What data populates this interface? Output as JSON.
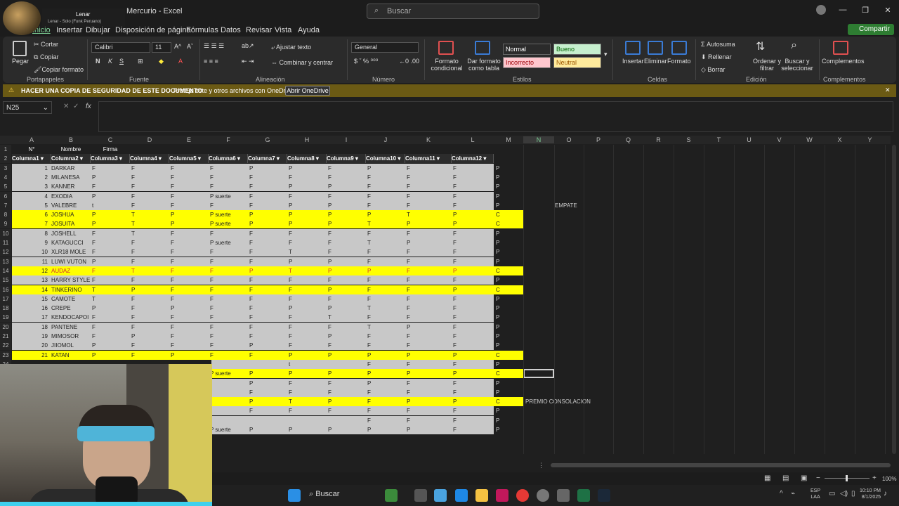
{
  "window": {
    "title": "Mercurio - Excel",
    "search_placeholder": "Buscar"
  },
  "overlay": {
    "now_playing_artist": "Lenar",
    "now_playing_song": "Lenar - Solo (Funk Peruano)"
  },
  "menu": {
    "tabs": [
      "Inicio",
      "Insertar",
      "Dibujar",
      "Disposición de página",
      "Fórmulas",
      "Datos",
      "Revisar",
      "Vista",
      "Ayuda"
    ],
    "share": "Compartir"
  },
  "ribbon": {
    "clipboard": {
      "paste": "Pegar",
      "cut": "Cortar",
      "copy": "Copiar",
      "format_painter": "Copiar formato",
      "label": "Portapapeles"
    },
    "font": {
      "name": "Calibri",
      "size": "11",
      "label": "Fuente"
    },
    "alignment": {
      "wrap": "Ajustar texto",
      "merge": "Combinar y centrar",
      "label": "Alineación"
    },
    "number": {
      "format": "General",
      "label": "Número"
    },
    "styles": {
      "conditional": "Formato condicional",
      "as_table": "Dar formato como tabla",
      "cells": [
        {
          "text": "Normal",
          "color": "#ffffff",
          "bg": "#2b2b2b"
        },
        {
          "text": "Bueno",
          "color": "#006100",
          "bg": "#c6efce"
        },
        {
          "text": "Incorrecto",
          "color": "#9c0006",
          "bg": "#ffc7ce"
        },
        {
          "text": "Neutral",
          "color": "#9c5700",
          "bg": "#ffeb9c"
        }
      ],
      "label": "Estilos"
    },
    "cells": {
      "insert": "Insertar",
      "delete": "Eliminar",
      "format": "Formato",
      "label": "Celdas"
    },
    "editing": {
      "autosum": "Autosuma",
      "fill": "Rellenar",
      "clear": "Borrar",
      "sort": "Ordenar y filtrar",
      "find": "Buscar y seleccionar",
      "label": "Edición"
    },
    "addins": {
      "text": "Complementos",
      "label": "Complementos"
    }
  },
  "notification": {
    "title": "HACER UNA COPIA DE SEGURIDAD DE ESTE DOCUMENTO",
    "body": "Proteja este y otros archivos con OneDrive.",
    "button": "Abrir OneDrive"
  },
  "formula_bar": {
    "name_box": "N25",
    "fx": "fx",
    "content": ""
  },
  "columns": [
    "A",
    "B",
    "C",
    "D",
    "E",
    "F",
    "G",
    "H",
    "I",
    "J",
    "K",
    "L",
    "M",
    "N",
    "O",
    "P",
    "Q",
    "R",
    "S",
    "T",
    "U",
    "V",
    "W",
    "X",
    "Y"
  ],
  "sheet": {
    "row1": [
      "N°",
      "Nombre",
      "Firma"
    ],
    "headers": [
      "Columna1",
      "Columna2",
      "Columna3",
      "Columna4",
      "Columna5",
      "Columna6",
      "Columna7",
      "Columna8",
      "Columna9",
      "Columna10",
      "Columna11",
      "Columna12"
    ],
    "rows": [
      {
        "n": "1",
        "name": "DARKAR",
        "c": [
          "F",
          "F",
          "F",
          "F",
          "P",
          "P",
          "F",
          "P",
          "F",
          "F"
        ],
        "m": "P",
        "hl": false
      },
      {
        "n": "2",
        "name": "MILANESA",
        "c": [
          "P",
          "F",
          "F",
          "F",
          "F",
          "F",
          "F",
          "F",
          "F",
          "F"
        ],
        "m": "P",
        "hl": false
      },
      {
        "n": "3",
        "name": "KANNER",
        "c": [
          "F",
          "F",
          "F",
          "F",
          "F",
          "P",
          "P",
          "F",
          "F",
          "F"
        ],
        "m": "P",
        "hl": false
      },
      {
        "n": "4",
        "name": "EXODIA",
        "c": [
          "P",
          "F",
          "F",
          "P suerte",
          "F",
          "F",
          "F",
          "F",
          "F",
          "F"
        ],
        "m": "P",
        "hl": false
      },
      {
        "n": "5",
        "name": "VALEBRE",
        "c": [
          "t",
          "F",
          "F",
          "F",
          "F",
          "P",
          "P",
          "F",
          "F",
          "F"
        ],
        "m": "P",
        "hl": false
      },
      {
        "n": "6",
        "name": "JOSHUA",
        "c": [
          "P",
          "T",
          "P",
          "P suerte",
          "P",
          "P",
          "P",
          "P",
          "T",
          "P"
        ],
        "m": "C",
        "hl": true
      },
      {
        "n": "7",
        "name": "JOSUITA",
        "c": [
          "P",
          "T",
          "P",
          "P suerte",
          "P",
          "P",
          "P",
          "T",
          "P",
          "P"
        ],
        "m": "C",
        "hl": true
      },
      {
        "n": "8",
        "name": "JOSHELL",
        "c": [
          "F",
          "T",
          "F",
          "F",
          "F",
          "F",
          "F",
          "F",
          "F",
          "F"
        ],
        "m": "P",
        "hl": false
      },
      {
        "n": "9",
        "name": "KATAGUCCI",
        "c": [
          "F",
          "F",
          "F",
          "P suerte",
          "F",
          "F",
          "F",
          "T",
          "P",
          "F"
        ],
        "m": "P",
        "hl": false
      },
      {
        "n": "10",
        "name": "XLR18 MOLE",
        "c": [
          "F",
          "F",
          "F",
          "F",
          "F",
          "T",
          "F",
          "F",
          "F",
          "F"
        ],
        "m": "P",
        "hl": false
      },
      {
        "n": "11",
        "name": "LUWI VUTON",
        "c": [
          "P",
          "F",
          "F",
          "F",
          "F",
          "P",
          "P",
          "F",
          "F",
          "F"
        ],
        "m": "P",
        "hl": false
      },
      {
        "n": "12",
        "name": "AUDAZ",
        "c": [
          "F",
          "T",
          "F",
          "F",
          "P",
          "T",
          "P",
          "P",
          "F",
          "P"
        ],
        "m": "C",
        "hl": true
      },
      {
        "n": "13",
        "name": "HARRY STYLE",
        "c": [
          "F",
          "F",
          "F",
          "F",
          "F",
          "F",
          "F",
          "F",
          "F",
          "F"
        ],
        "m": "P",
        "hl": false
      },
      {
        "n": "14",
        "name": "TINKERINO",
        "c": [
          "T",
          "P",
          "F",
          "F",
          "F",
          "F",
          "P",
          "F",
          "F",
          "P"
        ],
        "m": "C",
        "hl": true
      },
      {
        "n": "15",
        "name": "CAMOTE",
        "c": [
          "T",
          "F",
          "F",
          "F",
          "F",
          "F",
          "F",
          "F",
          "F",
          "F"
        ],
        "m": "P",
        "hl": false
      },
      {
        "n": "16",
        "name": "CREPE",
        "c": [
          "P",
          "F",
          "P",
          "F",
          "F",
          "P",
          "P",
          "T",
          "F",
          "F"
        ],
        "m": "P",
        "hl": false
      },
      {
        "n": "17",
        "name": "KENDOCAPOI",
        "c": [
          "F",
          "F",
          "F",
          "F",
          "F",
          "F",
          "T",
          "F",
          "F",
          "F"
        ],
        "m": "P",
        "hl": false
      },
      {
        "n": "18",
        "name": "PANTENE",
        "c": [
          "F",
          "F",
          "F",
          "F",
          "F",
          "F",
          "F",
          "T",
          "P",
          "F"
        ],
        "m": "P",
        "hl": false
      },
      {
        "n": "19",
        "name": "MIMOSOR",
        "c": [
          "F",
          "P",
          "F",
          "F",
          "F",
          "F",
          "P",
          "F",
          "F",
          "F"
        ],
        "m": "P",
        "hl": false
      },
      {
        "n": "20",
        "name": "JIIOMOL",
        "c": [
          "P",
          "F",
          "F",
          "F",
          "P",
          "F",
          "F",
          "F",
          "F",
          "F"
        ],
        "m": "P",
        "hl": false
      },
      {
        "n": "21",
        "name": "KATAN",
        "c": [
          "P",
          "F",
          "P",
          "F",
          "F",
          "P",
          "P",
          "P",
          "P",
          "P"
        ],
        "m": "C",
        "hl": true
      }
    ],
    "partial_rows": [
      {
        "c": [
          "",
          "",
          "",
          "",
          "",
          "t",
          "",
          "F",
          "F",
          "F"
        ],
        "m": "P",
        "hl": false
      },
      {
        "c": [
          "",
          "",
          "",
          "P suerte",
          "P",
          "P",
          "P",
          "P",
          "P",
          "P"
        ],
        "m": "C",
        "hl": true
      },
      {
        "c": [
          "",
          "",
          "",
          "",
          "P",
          "F",
          "F",
          "P",
          "F",
          "F"
        ],
        "m": "P",
        "hl": false
      },
      {
        "c": [
          "",
          "",
          "",
          "",
          "F",
          "F",
          "F",
          "F",
          "F",
          "F"
        ],
        "m": "P",
        "hl": false
      },
      {
        "c": [
          "",
          "",
          "",
          "",
          "P",
          "T",
          "P",
          "F",
          "P",
          "P"
        ],
        "m": "C",
        "hl": true
      },
      {
        "c": [
          "",
          "",
          "",
          "",
          "F",
          "F",
          "F",
          "F",
          "F",
          "F"
        ],
        "m": "P",
        "hl": false
      },
      {
        "c": [
          "",
          "",
          "",
          "",
          "",
          "",
          "",
          "F",
          "F",
          "F"
        ],
        "m": "P",
        "hl": false
      },
      {
        "c": [
          "",
          "",
          "",
          "P suerte",
          "P",
          "P",
          "P",
          "P",
          "P",
          "F"
        ],
        "m": "P",
        "hl": false
      }
    ],
    "notes": {
      "empate": "EMPATE",
      "premio": "PREMIO CONSOLACION"
    }
  },
  "statusbar": {
    "zoom": "100%"
  },
  "taskbar": {
    "search": "Buscar",
    "lang": "ESP",
    "lang2": "LAA",
    "time": "10:10 PM",
    "date": "8/1/2025"
  },
  "colors": {
    "highlight": "#ffff00",
    "rowgray": "#c8c8c8",
    "accent": "#7fd197",
    "notif": "#6b5a14"
  }
}
